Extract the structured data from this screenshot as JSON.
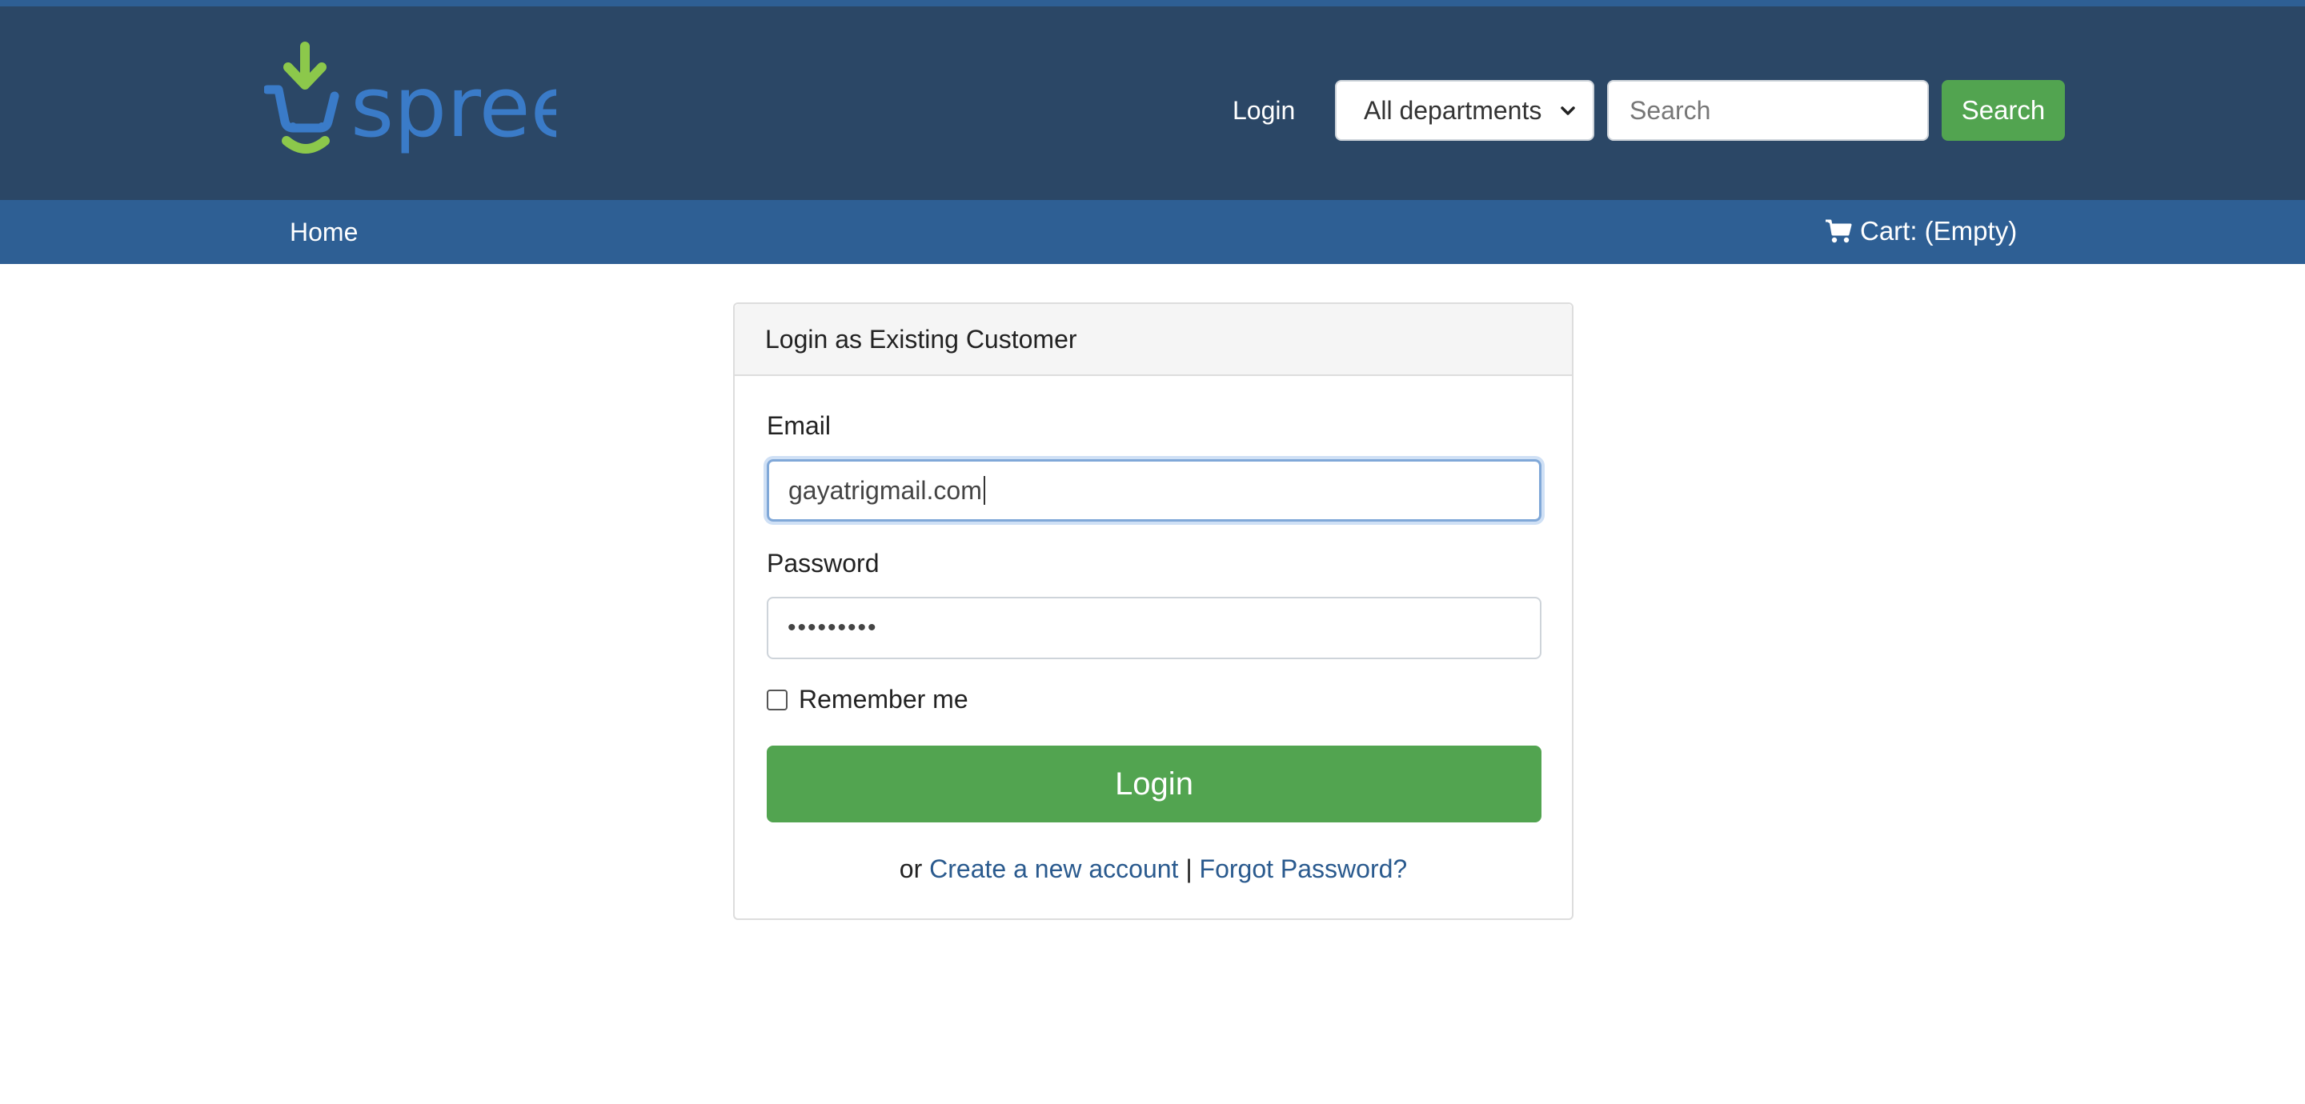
{
  "header": {
    "logo_text": "spree",
    "login_label": "Login",
    "department_select": "All departments",
    "search_placeholder": "Search",
    "search_button": "Search"
  },
  "nav": {
    "home": "Home",
    "cart": "Cart: (Empty)",
    "cart_icon": "cart-icon"
  },
  "login_card": {
    "title": "Login as Existing Customer",
    "email_label": "Email",
    "email_value": "gayatrigmail.com",
    "password_label": "Password",
    "password_value": "•••••••••",
    "remember_label": "Remember me",
    "remember_checked": false,
    "login_button": "Login",
    "or_text": "or",
    "create_account_link": "Create a new account",
    "separator": "|",
    "forgot_password_link": "Forgot Password?"
  },
  "colors": {
    "header_bg": "#2b4766",
    "nav_bg": "#2e5f94",
    "accent_green": "#52a450",
    "logo_blue": "#3a7bc8",
    "logo_green": "#8cc84b",
    "link_blue": "#2a5a8e"
  }
}
